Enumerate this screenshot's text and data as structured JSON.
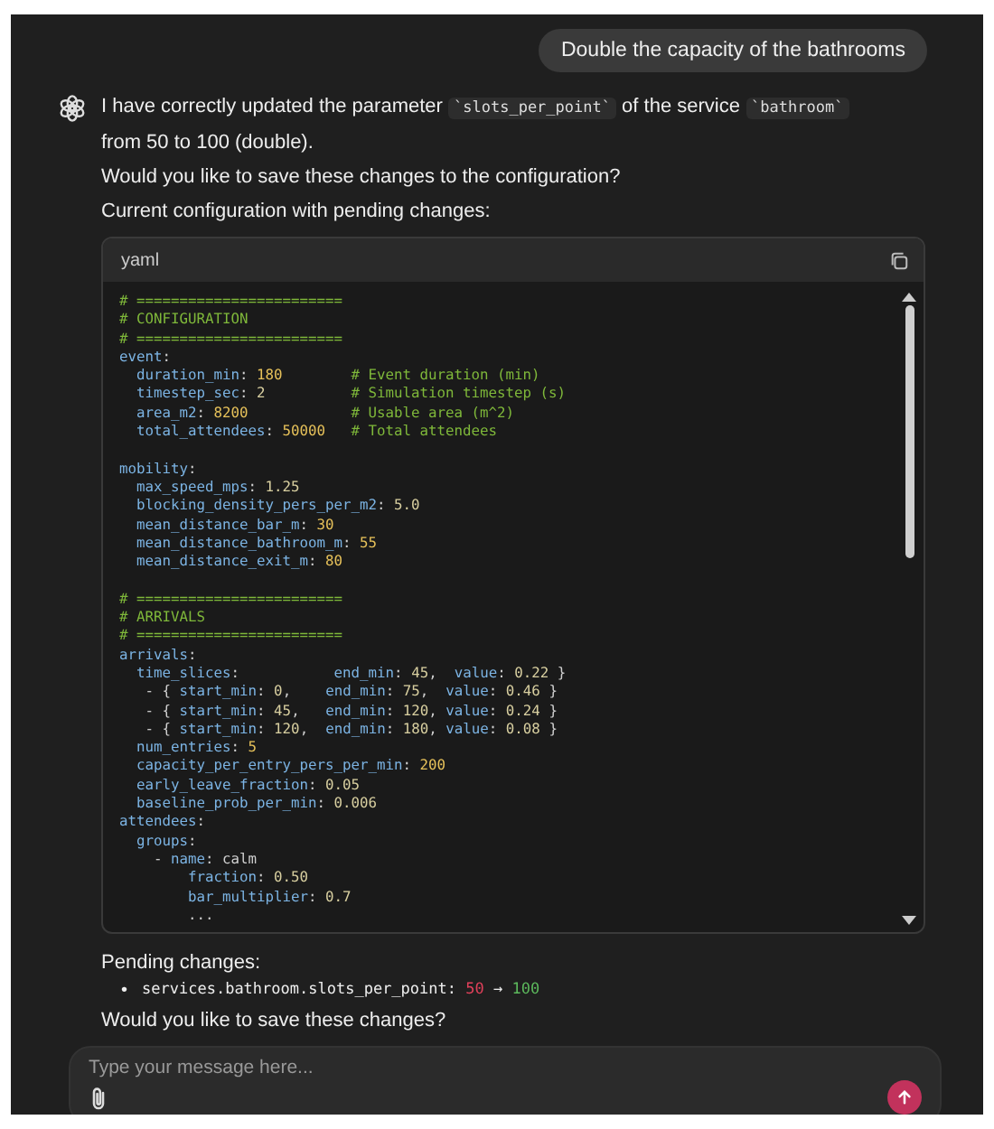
{
  "user_message": "Double the capacity of the bathrooms",
  "reply": {
    "paragraphs": [
      [
        {
          "kind": "text",
          "text": "I have correctly updated the parameter "
        },
        {
          "kind": "code",
          "text": "`slots_per_point`"
        },
        {
          "kind": "text",
          "text": " of the service "
        },
        {
          "kind": "code",
          "text": "`bathroom`"
        }
      ],
      [
        {
          "kind": "text",
          "text": "from 50 to 100 (double)."
        }
      ],
      [
        {
          "kind": "text",
          "text": "Would you like to save these changes to the configuration?"
        }
      ],
      [
        {
          "kind": "text",
          "text": "Current configuration with pending changes:"
        }
      ]
    ],
    "code_block": {
      "language": "yaml",
      "sections": [
        [
          {
            "tokens": [
              {
                "kind": "com",
                "text": "# ========================"
              }
            ]
          },
          {
            "tokens": [
              {
                "kind": "com",
                "text": "# CONFIGURATION"
              }
            ]
          },
          {
            "tokens": [
              {
                "kind": "com",
                "text": "# ========================"
              }
            ]
          },
          {
            "tokens": [
              {
                "kind": "key",
                "text": "event"
              },
              {
                "kind": "txt",
                "text": ":"
              }
            ]
          },
          {
            "tokens": [
              {
                "kind": "key",
                "text": "  duration_min"
              },
              {
                "kind": "txt",
                "text": ": "
              },
              {
                "kind": "num",
                "text": "180"
              }
            ],
            "comment": "# Event duration (min)"
          },
          {
            "tokens": [
              {
                "kind": "key",
                "text": "  timestep_sec"
              },
              {
                "kind": "txt",
                "text": ": "
              },
              {
                "kind": "flt",
                "text": "2"
              }
            ],
            "comment": "# Simulation timestep (s)"
          },
          {
            "tokens": [
              {
                "kind": "key",
                "text": "  area_m2"
              },
              {
                "kind": "txt",
                "text": ": "
              },
              {
                "kind": "num",
                "text": "8200"
              }
            ],
            "comment": "# Usable area (m^2)"
          },
          {
            "tokens": [
              {
                "kind": "key",
                "text": "  total_attendees"
              },
              {
                "kind": "txt",
                "text": ": "
              },
              {
                "kind": "num",
                "text": "50000"
              }
            ],
            "comment": "# Total attendees"
          }
        ],
        [
          {
            "tokens": [
              {
                "kind": "key",
                "text": "mobility"
              },
              {
                "kind": "txt",
                "text": ":"
              }
            ]
          },
          {
            "tokens": [
              {
                "kind": "key",
                "text": "  max_speed_mps"
              },
              {
                "kind": "txt",
                "text": ": "
              },
              {
                "kind": "flt",
                "text": "1.25"
              }
            ]
          },
          {
            "tokens": [
              {
                "kind": "key",
                "text": "  blocking_density_pers_per_m2"
              },
              {
                "kind": "txt",
                "text": ": "
              },
              {
                "kind": "flt",
                "text": "5.0"
              }
            ]
          },
          {
            "tokens": [
              {
                "kind": "key",
                "text": "  mean_distance_bar_m"
              },
              {
                "kind": "txt",
                "text": ": "
              },
              {
                "kind": "num",
                "text": "30"
              }
            ]
          },
          {
            "tokens": [
              {
                "kind": "key",
                "text": "  mean_distance_bathroom_m"
              },
              {
                "kind": "txt",
                "text": ": "
              },
              {
                "kind": "num",
                "text": "55"
              }
            ]
          },
          {
            "tokens": [
              {
                "kind": "key",
                "text": "  mean_distance_exit_m"
              },
              {
                "kind": "txt",
                "text": ": "
              },
              {
                "kind": "num",
                "text": "80"
              }
            ]
          }
        ],
        [
          {
            "tokens": [
              {
                "kind": "com",
                "text": "# ========================"
              }
            ]
          },
          {
            "tokens": [
              {
                "kind": "com",
                "text": "# ARRIVALS"
              }
            ]
          },
          {
            "tokens": [
              {
                "kind": "com",
                "text": "# ========================"
              }
            ]
          },
          {
            "tokens": [
              {
                "kind": "key",
                "text": "arrivals"
              },
              {
                "kind": "txt",
                "text": ":"
              }
            ]
          },
          {
            "tokens": [
              {
                "kind": "key",
                "text": "  time_slices"
              },
              {
                "kind": "txt",
                "text": ":           "
              },
              {
                "kind": "key",
                "text": "end_min"
              },
              {
                "kind": "txt",
                "text": ": "
              },
              {
                "kind": "flt",
                "text": "45"
              },
              {
                "kind": "txt",
                "text": ",  "
              },
              {
                "kind": "key",
                "text": "value"
              },
              {
                "kind": "txt",
                "text": ": "
              },
              {
                "kind": "flt",
                "text": "0.22"
              },
              {
                "kind": "txt",
                "text": " }"
              }
            ]
          },
          {
            "tokens": [
              {
                "kind": "txt",
                "text": "   - { "
              },
              {
                "kind": "key",
                "text": "start_min"
              },
              {
                "kind": "txt",
                "text": ": "
              },
              {
                "kind": "flt",
                "text": "0"
              },
              {
                "kind": "txt",
                "text": ",    "
              },
              {
                "kind": "key",
                "text": "end_min"
              },
              {
                "kind": "txt",
                "text": ": "
              },
              {
                "kind": "flt",
                "text": "75"
              },
              {
                "kind": "txt",
                "text": ",  "
              },
              {
                "kind": "key",
                "text": "value"
              },
              {
                "kind": "txt",
                "text": ": "
              },
              {
                "kind": "flt",
                "text": "0.46"
              },
              {
                "kind": "txt",
                "text": " }"
              }
            ]
          },
          {
            "tokens": [
              {
                "kind": "txt",
                "text": "   - { "
              },
              {
                "kind": "key",
                "text": "start_min"
              },
              {
                "kind": "txt",
                "text": ": "
              },
              {
                "kind": "flt",
                "text": "45"
              },
              {
                "kind": "txt",
                "text": ",   "
              },
              {
                "kind": "key",
                "text": "end_min"
              },
              {
                "kind": "txt",
                "text": ": "
              },
              {
                "kind": "flt",
                "text": "120"
              },
              {
                "kind": "txt",
                "text": ", "
              },
              {
                "kind": "key",
                "text": "value"
              },
              {
                "kind": "txt",
                "text": ": "
              },
              {
                "kind": "flt",
                "text": "0.24"
              },
              {
                "kind": "txt",
                "text": " }"
              }
            ]
          },
          {
            "tokens": [
              {
                "kind": "txt",
                "text": "   - { "
              },
              {
                "kind": "key",
                "text": "start_min"
              },
              {
                "kind": "txt",
                "text": ": "
              },
              {
                "kind": "flt",
                "text": "120"
              },
              {
                "kind": "txt",
                "text": ",  "
              },
              {
                "kind": "key",
                "text": "end_min"
              },
              {
                "kind": "txt",
                "text": ": "
              },
              {
                "kind": "flt",
                "text": "180"
              },
              {
                "kind": "txt",
                "text": ", "
              },
              {
                "kind": "key",
                "text": "value"
              },
              {
                "kind": "txt",
                "text": ": "
              },
              {
                "kind": "flt",
                "text": "0.08"
              },
              {
                "kind": "txt",
                "text": " }"
              }
            ]
          },
          {
            "tokens": [
              {
                "kind": "key",
                "text": "  num_entries"
              },
              {
                "kind": "txt",
                "text": ": "
              },
              {
                "kind": "num",
                "text": "5"
              }
            ]
          },
          {
            "tokens": [
              {
                "kind": "key",
                "text": "  capacity_per_entry_pers_per_min"
              },
              {
                "kind": "txt",
                "text": ": "
              },
              {
                "kind": "num",
                "text": "200"
              }
            ]
          },
          {
            "tokens": [
              {
                "kind": "key",
                "text": "  early_leave_fraction"
              },
              {
                "kind": "txt",
                "text": ": "
              },
              {
                "kind": "flt",
                "text": "0.05"
              }
            ]
          },
          {
            "tokens": [
              {
                "kind": "key",
                "text": "  baseline_prob_per_min"
              },
              {
                "kind": "txt",
                "text": ": "
              },
              {
                "kind": "flt",
                "text": "0.006"
              }
            ]
          },
          {
            "tokens": [
              {
                "kind": "key",
                "text": "attendees"
              },
              {
                "kind": "txt",
                "text": ":"
              }
            ]
          },
          {
            "tokens": [
              {
                "kind": "key",
                "text": "  groups"
              },
              {
                "kind": "txt",
                "text": ":"
              }
            ]
          },
          {
            "tokens": [
              {
                "kind": "txt",
                "text": "    - "
              },
              {
                "kind": "key",
                "text": "name"
              },
              {
                "kind": "txt",
                "text": ": calm"
              }
            ]
          },
          {
            "tokens": [
              {
                "kind": "key",
                "text": "        fraction"
              },
              {
                "kind": "txt",
                "text": ": "
              },
              {
                "kind": "flt",
                "text": "0.50"
              }
            ]
          },
          {
            "tokens": [
              {
                "kind": "key",
                "text": "        bar_multiplier"
              },
              {
                "kind": "txt",
                "text": ": "
              },
              {
                "kind": "flt",
                "text": "0.7"
              }
            ]
          },
          {
            "tokens": [
              {
                "kind": "txt",
                "text": "        ..."
              }
            ]
          }
        ]
      ]
    },
    "pending_title": "Pending changes:",
    "pending_changes": [
      {
        "marker": "•",
        "path": "services.bathroom.slots_per_point:",
        "old": "50",
        "arrow": "→",
        "new": "100"
      }
    ],
    "question": "Would you like to save these changes?"
  },
  "composer": {
    "placeholder": "Type your message here..."
  }
}
